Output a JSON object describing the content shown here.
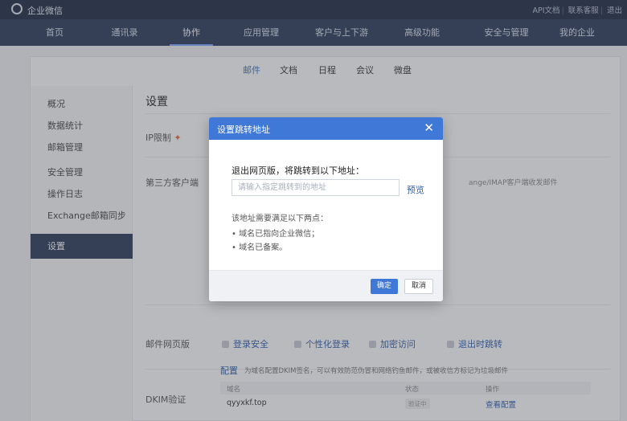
{
  "app": {
    "brand": "企业微信",
    "top_links": [
      "API文档",
      "联系客服",
      "退出"
    ]
  },
  "nav": {
    "items": [
      "首页",
      "通讯录",
      "协作",
      "应用管理",
      "客户与上下游",
      "高级功能",
      "安全与管理",
      "我的企业"
    ],
    "active": "协作"
  },
  "subtabs": {
    "items": [
      "邮件",
      "文档",
      "日程",
      "会议",
      "微盘"
    ],
    "active": "邮件"
  },
  "sidebar": {
    "items": [
      "概况",
      "数据统计",
      "邮箱管理",
      "安全管理",
      "操作日志",
      "Exchange邮箱同步",
      "设置"
    ],
    "active": "设置"
  },
  "content": {
    "title": "设置",
    "ip_limit_label": "IP限制",
    "third_party_label": "第三方客户端",
    "third_party_hint": "ange/IMAP客户端收发邮件",
    "webmail_label": "邮件网页版",
    "webmail_features": [
      "登录安全",
      "个性化登录",
      "加密访问",
      "退出时跳转"
    ],
    "dkim_label": "DKIM验证",
    "dkim_config": "配置",
    "dkim_desc": "为域名配置DKIM签名，可以有效防范伪冒和网络钓鱼邮件，或被收信方标记为垃圾邮件",
    "table_headers": [
      "域名",
      "状态",
      "操作"
    ],
    "table_rows": [
      {
        "domain": "qyyxkf.top",
        "status": "验证中",
        "action": "查看配置"
      }
    ]
  },
  "dialog": {
    "title": "设置跳转地址",
    "close_symbol": "✕",
    "label": "退出网页版，将跳转到以下地址：",
    "input_placeholder": "请输入指定跳转到的地址",
    "input_value": "",
    "preview": "预览",
    "requirements_title": "该地址需要满足以下两点：",
    "requirements": [
      "域名已指向企业微信；",
      "域名已备案。"
    ],
    "ok": "确定",
    "cancel": "取消"
  },
  "colors": {
    "accent": "#3f78d7",
    "topbar": "#1e2b44",
    "nav": "#2a3a5b"
  }
}
